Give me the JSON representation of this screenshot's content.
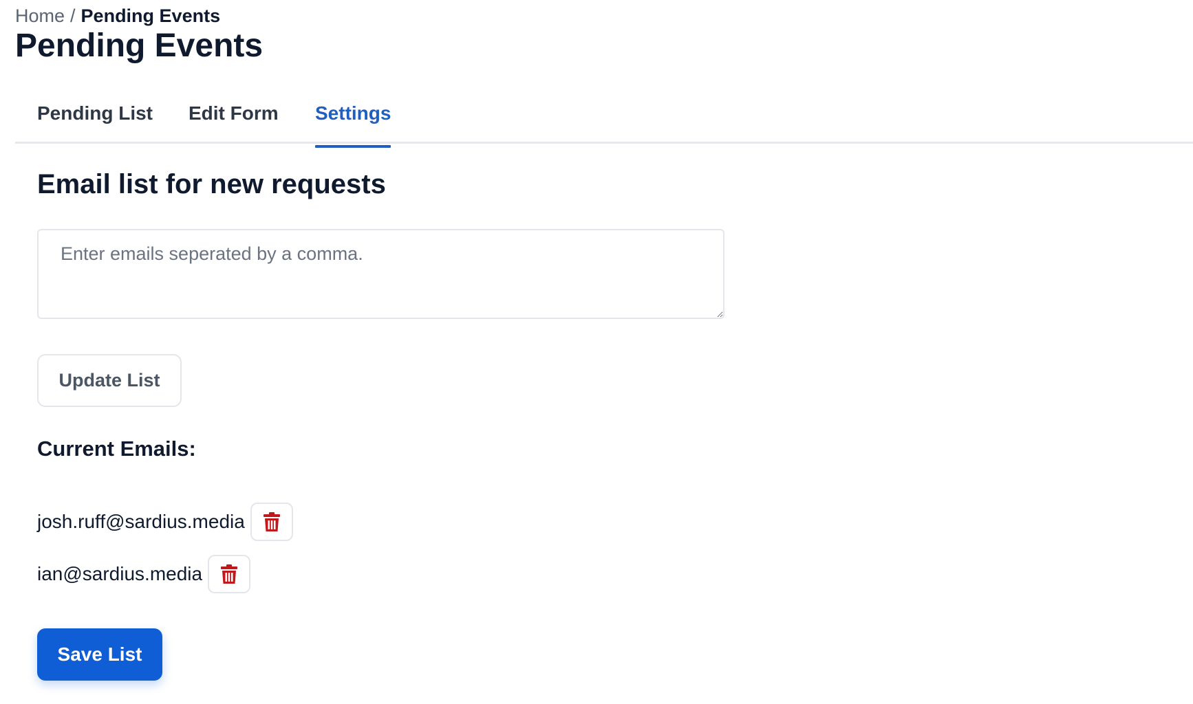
{
  "breadcrumb": {
    "home": "Home",
    "separator": "/",
    "current": "Pending Events"
  },
  "page_title": "Pending Events",
  "tabs": [
    {
      "label": "Pending List",
      "active": false
    },
    {
      "label": "Edit Form",
      "active": false
    },
    {
      "label": "Settings",
      "active": true
    }
  ],
  "settings": {
    "heading": "Email list for new requests",
    "textarea": {
      "placeholder": "Enter emails seperated by a comma.",
      "value": ""
    },
    "update_button": "Update List",
    "current_heading": "Current Emails:",
    "emails": [
      {
        "address": "josh.ruff@sardius.media",
        "delete_icon": "trash-icon"
      },
      {
        "address": "ian@sardius.media",
        "delete_icon": "trash-icon"
      }
    ],
    "save_button": "Save List"
  },
  "colors": {
    "accent": "#1f5fbf",
    "primary_button": "#0f5ed6",
    "delete_icon": "#c0191b",
    "text": "#0f1a2e",
    "muted": "#5b6472",
    "border": "#e3e6ea"
  }
}
